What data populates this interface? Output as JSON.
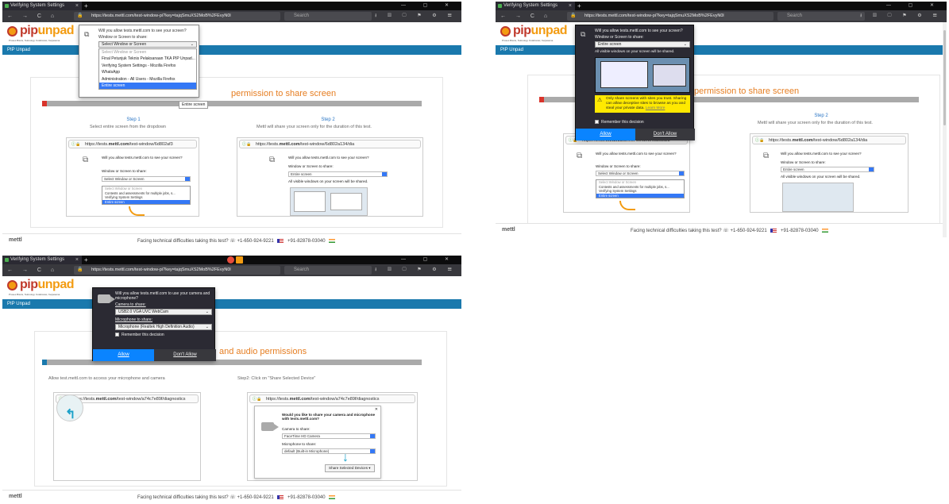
{
  "browser": {
    "tab_title": "Verifying System Settings",
    "tab_close": "×",
    "new_tab": "+",
    "window_controls": "— ▢ ✕",
    "nav_buttons": "← → C ⌂",
    "url": "https://tests.mettl.com/test-window-pi?key=tajqSmuXS2MoB%2FEvyN0l",
    "search_placeholder": "Search",
    "toolbar_icons": "⭳ ▥ ▢ ⚑ ⚙ ☰",
    "overflow": "···  ♡  ☆"
  },
  "site": {
    "logo_text_a": "pip",
    "logo_text_b": "unpad",
    "logo_tagline": "Proses Bisnis, Teknologi, Kolaborasi, Kerjasama",
    "nav_label": "PIP Unpad",
    "footer_brand": "mettl",
    "footer_help": "Facing technical difficulties taking this test?",
    "footer_phone_us": "+1-650-924-9221",
    "footer_phone_in": "+91-82878-03040"
  },
  "panel1": {
    "dialog_question": "Will you allow tests.mettl.com to see your screen?",
    "dialog_label": "Window or Screen to share:",
    "dialog_selected": "Select Window or Screen",
    "options": [
      "Select Window or Screen",
      "Final Petunjuk Teknis Pelaksanaan TKA PIP Unpad...",
      "Verifying System Settings - Mozilla Firefox",
      "WhatsApp",
      "Administration - All Users - Mozilla Firefox",
      "Entire screen"
    ],
    "tooltip": "Entire screen",
    "heading": "permission to share screen",
    "step1_title": "Step 1",
    "step1_desc": "Select entire screen from the dropdown",
    "step2_title": "Step 2",
    "step2_desc": "Mettl will share your screen only for the duration of this test.",
    "mini_url_prefix": "https://tests.",
    "mini_url_bold": "mettl.com",
    "mini_url_suffix1": "/test-window/6d802af3",
    "mini_url_suffix2": "/test-window/6d802a134/dia",
    "mini_question": "Will you allow tests.mettl.com to see your screen?",
    "mini_label": "Window or Screen to share:",
    "mini_selected": "Select Window or Screen",
    "mini_selected2": "Entire screen",
    "mini_options": [
      "Select Window or Screen",
      "Contests and assessments for multiple jobs, s...",
      "Verifying System Settings",
      "Entire screen"
    ],
    "mini_visible_note": "All visible windows on your screen will be shared."
  },
  "panel2": {
    "dialog_question": "Will you allow tests.mettl.com to see your screen?",
    "dialog_label": "Window or Screen to share:",
    "dialog_selected": "Entire screen",
    "dialog_note": "All visible windows on your screen will be shared.",
    "warning": "Only share screens with sites you trust. Sharing can allow deceptive sites to browse as you and steal your private data.",
    "warning_link": "Learn More",
    "remember": "Remember this decision",
    "allow": "Allow",
    "dont_allow": "Don't Allow",
    "heading": "permission to share screen",
    "step2_title": "Step 2",
    "step2_desc": "Mettl will share your screen only for the duration of this test."
  },
  "panel3": {
    "dialog_question": "Will you allow tests.mettl.com to use your camera and microphone?",
    "camera_label": "Camera to share:",
    "camera_value": "USB2.0 VGA UVC WebCam",
    "mic_label": "Microphone to share:",
    "mic_value": "Microphone (Realtek High Definition Audio)",
    "remember": "Remember this decision",
    "allow": "Allow",
    "dont_allow": "Don't Allow",
    "heading": "and audio permissions",
    "step1_desc": "Allow test.mettl.com to access your microphone and camera",
    "step2_desc": "Step2: Click on \"Share Selected Device\"",
    "mini_url_suffix1": "/test-window/a74c7e89f/diagnostics",
    "mini_url_suffix2": "/test-window/a74c7e89f/diagnostics",
    "chrome_question": "Would you like to share your camera and microphone with tests.mettl.com?",
    "chrome_camera_label": "Camera to share:",
    "chrome_camera_value": "FaceTime HD Camera",
    "chrome_mic_label": "Microphone to share:",
    "chrome_mic_value": "default (Built-in Microphone)",
    "share_button": "Share Selected Devices"
  },
  "colors": {
    "accent_orange": "#e67e22",
    "brand_blue": "#1a79ad",
    "progress_red": "#d9342b",
    "progress_blue": "#1a79ad",
    "select_blue": "#3478f6"
  }
}
